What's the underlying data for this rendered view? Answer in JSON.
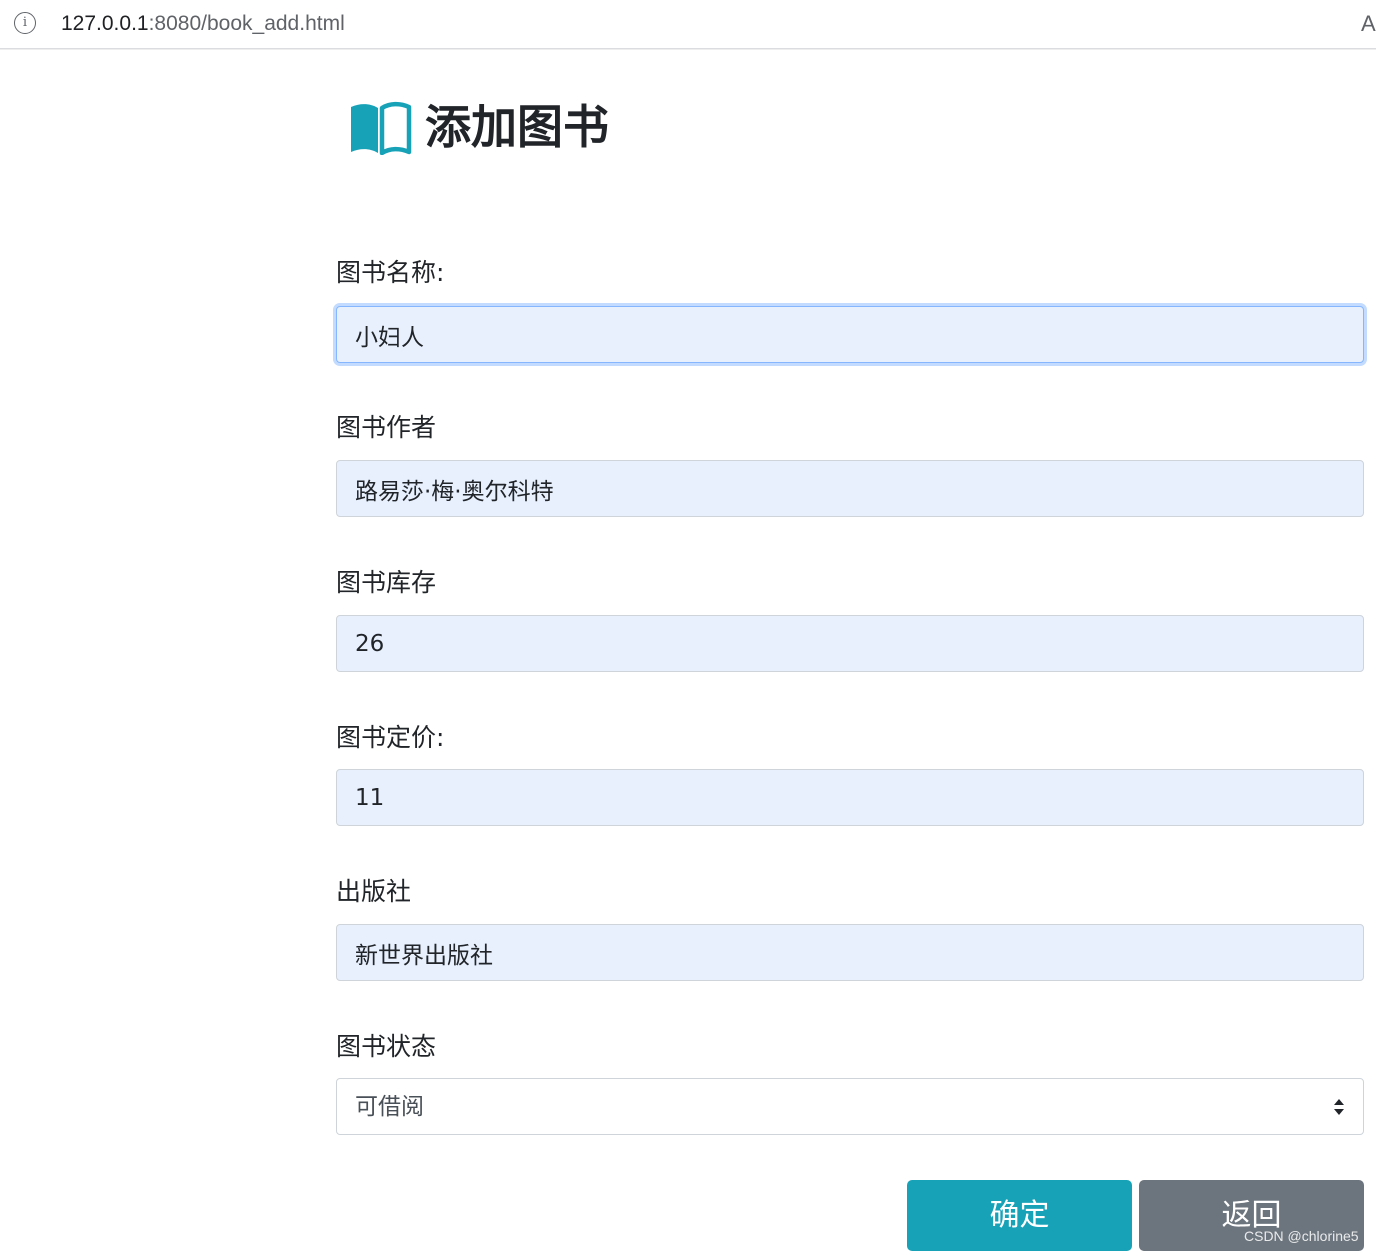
{
  "browser": {
    "url_host": "127.0.0.1",
    "url_path": ":8080/book_add.html",
    "info_icon": "i",
    "reader_icon": "A"
  },
  "page": {
    "title": "添加图书",
    "title_icon": "book-open-icon",
    "accent_color": "#17a2b8"
  },
  "form": {
    "name": {
      "label": "图书名称:",
      "value": "小妇人"
    },
    "author": {
      "label": "图书作者",
      "value": "路易莎·梅·奥尔科特"
    },
    "stock": {
      "label": "图书库存",
      "value": "26"
    },
    "price": {
      "label": "图书定价:",
      "value": "11"
    },
    "publisher": {
      "label": "出版社",
      "value": "新世界出版社"
    },
    "status": {
      "label": "图书状态",
      "selected": "可借阅"
    }
  },
  "buttons": {
    "confirm": "确定",
    "back": "返回"
  },
  "watermark": "CSDN @chlorine5"
}
